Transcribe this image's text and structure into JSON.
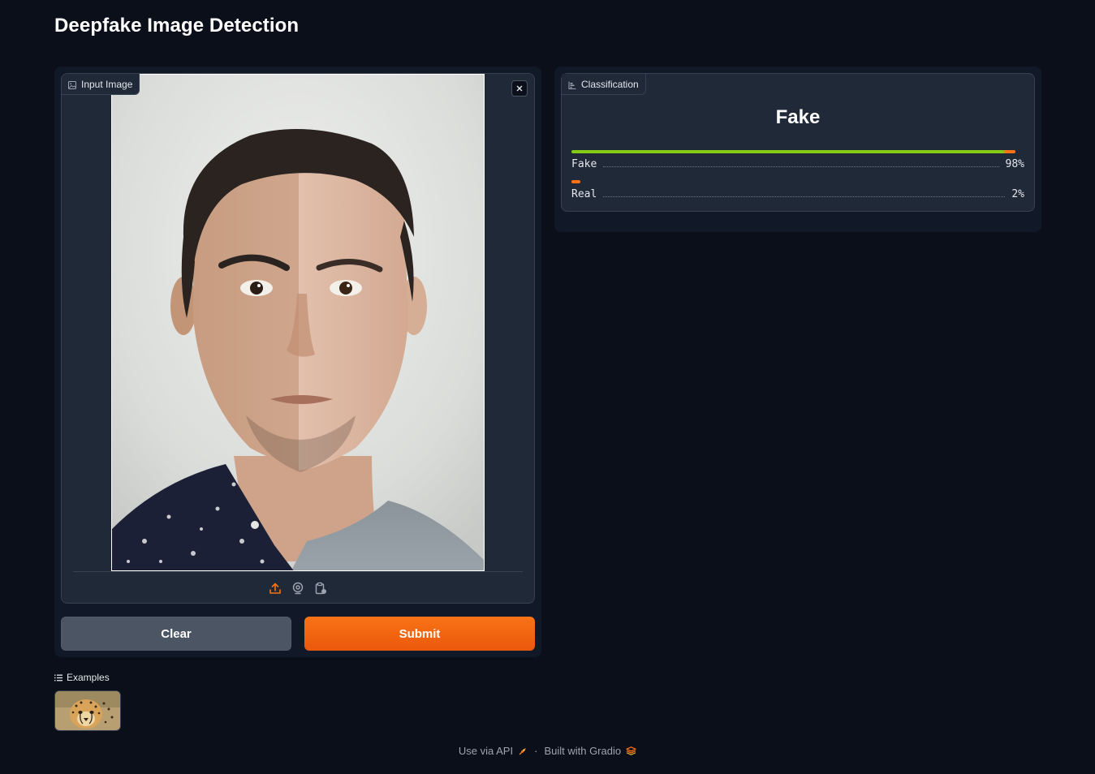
{
  "app": {
    "title": "Deepfake Image Detection"
  },
  "input": {
    "label": "Input Image",
    "icon": "image-icon",
    "sources": [
      "upload-icon",
      "webcam-icon",
      "clipboard-icon"
    ]
  },
  "buttons": {
    "clear": "Clear",
    "submit": "Submit"
  },
  "output": {
    "label": "Classification",
    "icon": "bar-chart-icon",
    "predicted": "Fake",
    "confidences": [
      {
        "label": "Fake",
        "value": 0.98,
        "display": "98%"
      },
      {
        "label": "Real",
        "value": 0.02,
        "display": "2%"
      }
    ]
  },
  "examples": {
    "label": "Examples"
  },
  "footer": {
    "api": "Use via API",
    "separator": "·",
    "built": "Built with Gradio"
  },
  "colors": {
    "accent": "#f97316",
    "background": "#0b0f19",
    "panel": "#111827",
    "block": "#1f2937",
    "confidence_bar": "#84cc16"
  }
}
